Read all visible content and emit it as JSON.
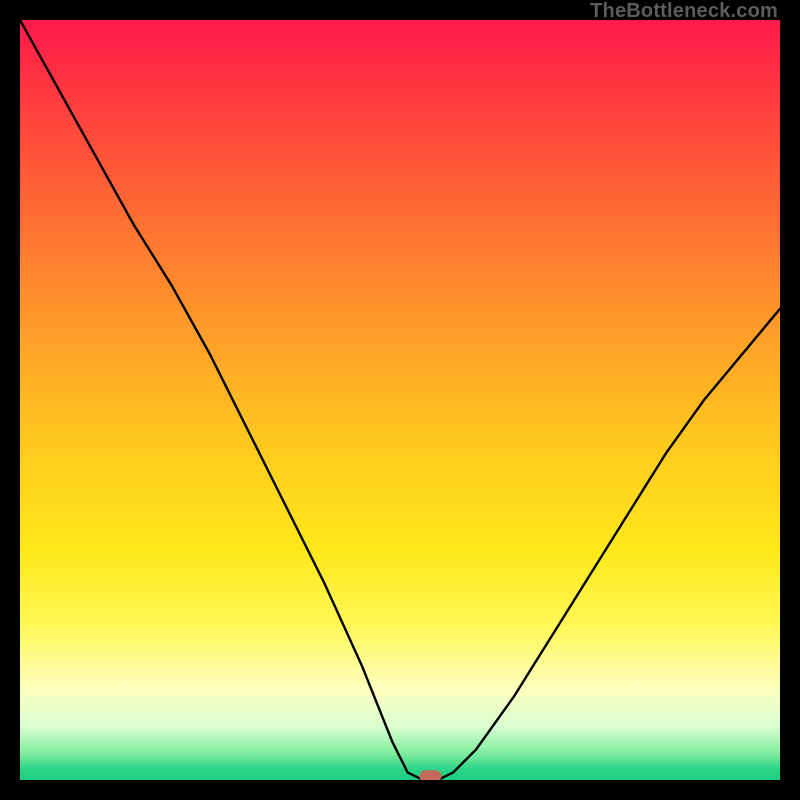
{
  "watermark": "TheBottleneck.com",
  "chart_data": {
    "type": "line",
    "title": "",
    "xlabel": "",
    "ylabel": "",
    "xlim": [
      0,
      100
    ],
    "ylim": [
      0,
      100
    ],
    "x": [
      0,
      5,
      10,
      15,
      20,
      25,
      30,
      35,
      40,
      45,
      49,
      51,
      53,
      54,
      55,
      57,
      60,
      65,
      70,
      75,
      80,
      85,
      90,
      95,
      100
    ],
    "values": [
      100,
      91,
      82,
      73,
      65,
      56,
      46,
      36,
      26,
      15,
      5,
      1,
      0,
      0,
      0,
      1,
      4,
      11,
      19,
      27,
      35,
      43,
      50,
      56,
      62
    ],
    "marker": {
      "x": 54,
      "y": 0.5
    },
    "gradient_bands": [
      {
        "offset": 0.0,
        "color": "#ff1a4b"
      },
      {
        "offset": 0.1,
        "color": "#ff3a3f"
      },
      {
        "offset": 0.25,
        "color": "#ff6a33"
      },
      {
        "offset": 0.4,
        "color": "#ff9a2a"
      },
      {
        "offset": 0.55,
        "color": "#ffc71f"
      },
      {
        "offset": 0.7,
        "color": "#ffe91a"
      },
      {
        "offset": 0.8,
        "color": "#fff85a"
      },
      {
        "offset": 0.88,
        "color": "#fdffbf"
      },
      {
        "offset": 0.93,
        "color": "#d9ffd0"
      },
      {
        "offset": 0.965,
        "color": "#7eec9e"
      },
      {
        "offset": 0.985,
        "color": "#2fd688"
      },
      {
        "offset": 1.0,
        "color": "#1ccf82"
      }
    ]
  }
}
